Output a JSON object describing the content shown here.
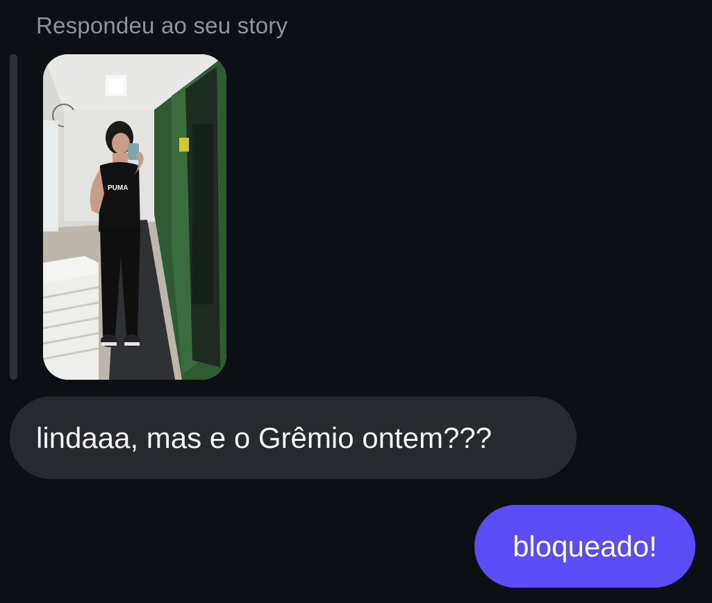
{
  "conversation": {
    "reply_caption": "Respondeu ao seu story",
    "story": {
      "kind": "photo",
      "subject": "mirror-selfie",
      "shirt_logo_text": "PUMA"
    },
    "messages": [
      {
        "direction": "received",
        "text": "lindaaa, mas e o Grêmio ontem???"
      },
      {
        "direction": "sent",
        "text": "bloqueado!"
      }
    ]
  },
  "colors": {
    "background": "#0c1014",
    "caption_text": "#8e959e",
    "received_bubble": "#262a2f",
    "sent_bubble": "#5b4cf5"
  }
}
